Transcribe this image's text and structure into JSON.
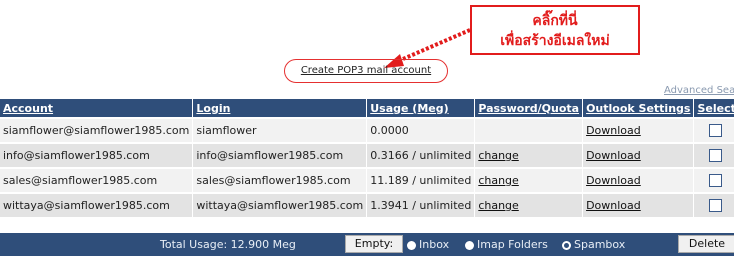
{
  "callout": {
    "line1": "คลิ๊กที่นี่",
    "line2": "เพื่อสร้างอีเมลใหม่",
    "color": "#e21c1c"
  },
  "create_link": "Create POP3 mail account",
  "advanced_search": "Advanced Search",
  "table": {
    "headers": [
      "Account",
      "Login",
      "Usage (Meg)",
      "Password/Quota",
      "Outlook Settings",
      "Select"
    ],
    "rows": [
      {
        "account": "siamflower@siamflower1985.com",
        "login": "siamflower",
        "usage": "0.0000",
        "password": "",
        "outlook": "Download"
      },
      {
        "account": "info@siamflower1985.com",
        "login": "info@siamflower1985.com",
        "usage": "0.3166 / unlimited",
        "password": "change",
        "outlook": "Download"
      },
      {
        "account": "sales@siamflower1985.com",
        "login": "sales@siamflower1985.com",
        "usage": "11.189 / unlimited",
        "password": "change",
        "outlook": "Download"
      },
      {
        "account": "wittaya@siamflower1985.com",
        "login": "wittaya@siamflower1985.com",
        "usage": "1.3941 / unlimited",
        "password": "change",
        "outlook": "Download"
      }
    ]
  },
  "footer": {
    "total_usage": "Total Usage: 12.900 Meg",
    "empty_label": "Empty:",
    "options": [
      "Inbox",
      "Imap Folders",
      "Spambox"
    ],
    "selected_option": "Spambox",
    "delete_label": "Delete"
  },
  "colors": {
    "header_bg": "#2f4e7a",
    "row_light": "#f2f2f2",
    "row_dark": "#e3e3e3"
  }
}
